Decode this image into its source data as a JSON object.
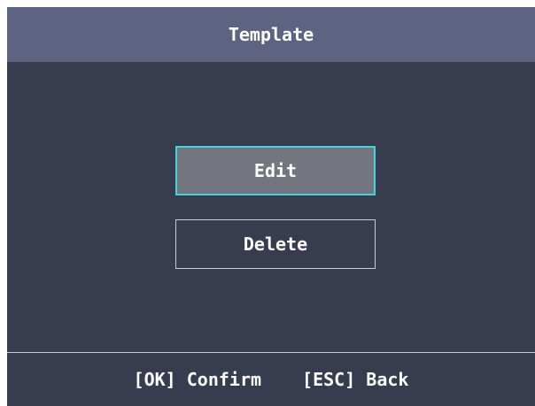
{
  "header": {
    "title": "Template"
  },
  "menu": {
    "items": [
      {
        "label": "Edit",
        "selected": true
      },
      {
        "label": "Delete",
        "selected": false
      }
    ]
  },
  "footer": {
    "confirm_hint": "[OK] Confirm",
    "back_hint": "[ESC] Back"
  },
  "colors": {
    "title_bar": "#5d6381",
    "screen_background": "#373c4f",
    "selected_fill": "#73767f",
    "selected_border": "#3fd6d8",
    "border": "#c9ccd6",
    "text": "#ffffff"
  }
}
